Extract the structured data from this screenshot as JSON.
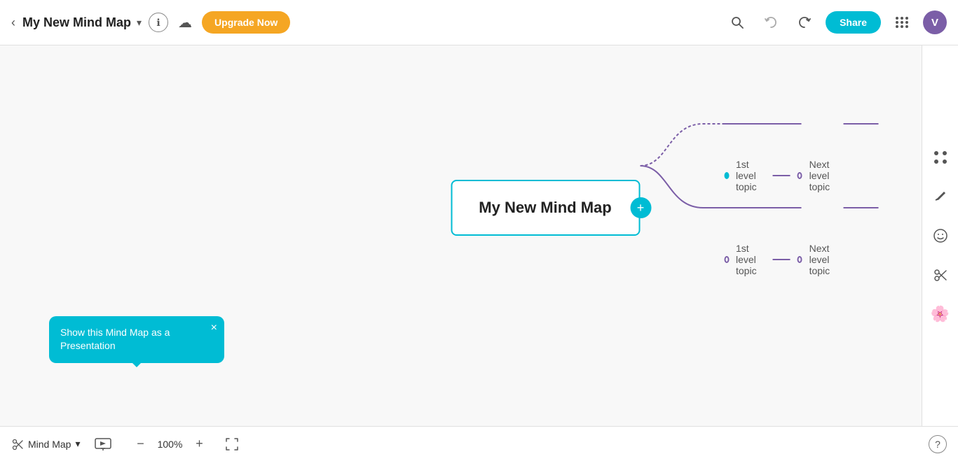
{
  "header": {
    "back_label": "‹",
    "title": "My New Mind Map",
    "chevron": "▾",
    "info_label": "ℹ",
    "cloud_label": "☁",
    "upgrade_label": "Upgrade Now",
    "search_label": "🔍",
    "undo_label": "↩",
    "redo_label": "↪",
    "share_label": "Share",
    "avatar_label": "V"
  },
  "canvas": {
    "central_node_text": "My New Mind Map",
    "plus_label": "+",
    "topics": [
      {
        "id": "topic1",
        "level1_label": "1st level topic",
        "level2_label": "Next level topic"
      },
      {
        "id": "topic2",
        "level1_label": "1st level topic",
        "level2_label": "Next level topic"
      }
    ]
  },
  "right_toolbar": {
    "layout_icon": "⊞",
    "pin_icon": "✏",
    "emoji_icon": "☺",
    "cut_icon": "✂",
    "flower_icon": "🌸"
  },
  "bottom_bar": {
    "mode_label": "Mind Map",
    "chevron": "▾",
    "presentation_icon": "▶",
    "zoom_minus": "−",
    "zoom_level": "100%",
    "zoom_plus": "+",
    "fit_icon": "⛶",
    "help_icon": "?"
  },
  "tooltip": {
    "text": "Show this Mind Map as a Presentation",
    "close_icon": "×"
  },
  "colors": {
    "cyan": "#00bcd4",
    "purple": "#7b5ea7",
    "orange": "#f5a623",
    "avatar_bg": "#7b5ea7"
  }
}
